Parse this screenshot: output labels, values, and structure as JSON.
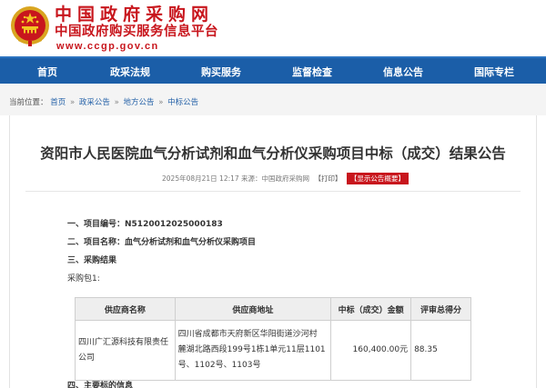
{
  "site": {
    "name": "中国政府采购网",
    "subtitle": "中国政府购买服务信息平台",
    "url": "www.ccgp.gov.cn"
  },
  "nav": {
    "items": [
      "首页",
      "政采法规",
      "购买服务",
      "监督检查",
      "信息公告",
      "国际专栏"
    ]
  },
  "breadcrumb": {
    "label": "当前位置：",
    "items": [
      "首页",
      "政采公告",
      "地方公告",
      "中标公告"
    ],
    "separator": "»"
  },
  "notice": {
    "title": "资阳市人民医院血气分析试剂和血气分析仪采购项目中标（成交）结果公告",
    "meta": "2025年08月21日 12:17 来源：中国政府采购网",
    "print_label": "【打印】",
    "show_summary_label": "【显示公告概要】"
  },
  "sections": {
    "project_no_label": "一、项目编号：",
    "project_no": "N5120012025000183",
    "project_name_label": "二、项目名称：",
    "project_name": "血气分析试剂和血气分析仪采购项目",
    "result_label": "三、采购结果",
    "package_label": "采购包1:",
    "next_label": "四、主要标的信息"
  },
  "table": {
    "headers": [
      "供应商名称",
      "供应商地址",
      "中标（成交）金额",
      "评审总得分"
    ],
    "rows": [
      {
        "supplier_line1": "四川广汇源科技有限责任",
        "supplier_line2": "公司",
        "address_line1": "四川省成都市天府新区华阳街道沙河村",
        "address_line2": "麓湖北路西段199号1栋1单元11层1101",
        "address_line3": "号、1102号、1103号",
        "amount": "160,400.00元",
        "score": "88.35"
      }
    ]
  },
  "colors": {
    "brand_red": "#c8161d",
    "nav_blue": "#1b5ea8",
    "link_blue": "#2763a9"
  }
}
